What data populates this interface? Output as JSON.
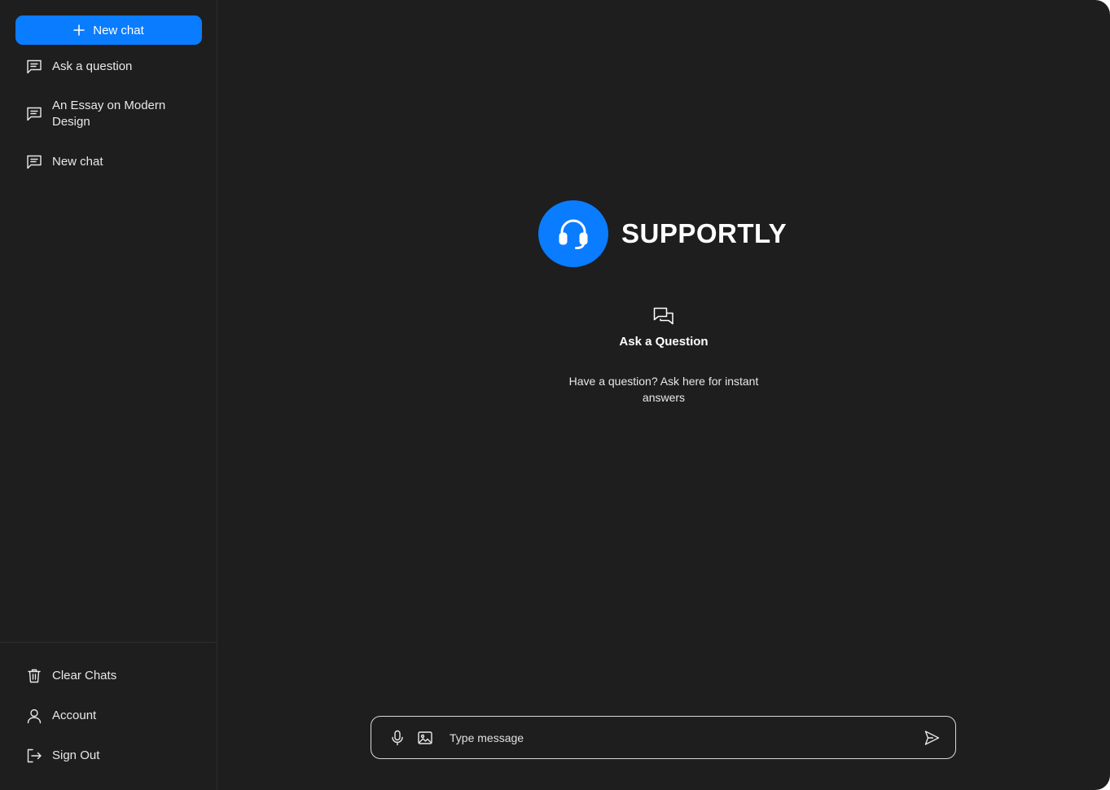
{
  "sidebar": {
    "new_chat_label": "New chat",
    "chats": [
      {
        "label": "Ask a question",
        "icon": "chat-icon"
      },
      {
        "label": "An Essay on Modern Design",
        "icon": "chat-icon"
      },
      {
        "label": "New chat",
        "icon": "chat-icon"
      }
    ],
    "bottom": {
      "clear_chats": "Clear Chats",
      "account": "Account",
      "sign_out": "Sign Out"
    }
  },
  "main": {
    "brand_name": "SUPPORTLY",
    "brand_icon": "headset-icon",
    "section_title": "Ask a Question",
    "section_icon": "chat-bubbles-icon",
    "section_description": "Have a question? Ask here for instant answers"
  },
  "composer": {
    "placeholder": "Type message",
    "icons": [
      "microphone-icon",
      "image-icon",
      "send-icon"
    ]
  },
  "colors": {
    "background": "#1e1e1f",
    "accent": "#0a7cff",
    "text": "#ffffff",
    "border": "#d9d9d9"
  }
}
